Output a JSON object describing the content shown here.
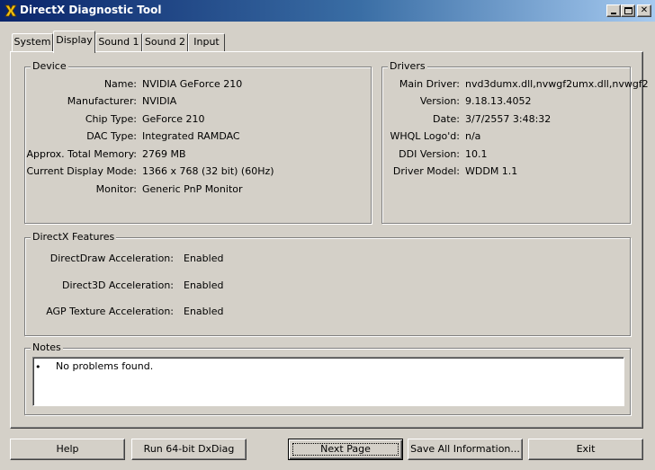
{
  "window": {
    "title": "DirectX Diagnostic Tool"
  },
  "tabs": [
    {
      "label": "System"
    },
    {
      "label": "Display"
    },
    {
      "label": "Sound 1"
    },
    {
      "label": "Sound 2"
    },
    {
      "label": "Input"
    }
  ],
  "active_tab": "Display",
  "device": {
    "title": "Device",
    "fields": [
      {
        "label": "Name:",
        "value": "NVIDIA GeForce 210"
      },
      {
        "label": "Manufacturer:",
        "value": "NVIDIA"
      },
      {
        "label": "Chip Type:",
        "value": "GeForce 210"
      },
      {
        "label": "DAC Type:",
        "value": "Integrated RAMDAC"
      },
      {
        "label": "Approx. Total Memory:",
        "value": "2769 MB"
      },
      {
        "label": "Current Display Mode:",
        "value": "1366 x 768 (32 bit) (60Hz)"
      },
      {
        "label": "Monitor:",
        "value": "Generic PnP Monitor"
      }
    ]
  },
  "drivers": {
    "title": "Drivers",
    "fields": [
      {
        "label": "Main Driver:",
        "value": "nvd3dumx.dll,nvwgf2umx.dll,nvwgf2"
      },
      {
        "label": "Version:",
        "value": "9.18.13.4052"
      },
      {
        "label": "Date:",
        "value": "3/7/2557 3:48:32"
      },
      {
        "label": "WHQL Logo'd:",
        "value": "n/a"
      },
      {
        "label": "DDI Version:",
        "value": "10.1"
      },
      {
        "label": "Driver Model:",
        "value": "WDDM 1.1"
      }
    ]
  },
  "features": {
    "title": "DirectX Features",
    "fields": [
      {
        "label": "DirectDraw Acceleration:",
        "value": "Enabled"
      },
      {
        "label": "Direct3D Acceleration:",
        "value": "Enabled"
      },
      {
        "label": "AGP Texture Acceleration:",
        "value": "Enabled"
      }
    ]
  },
  "notes": {
    "title": "Notes",
    "bullet": "•",
    "items": [
      "No problems found."
    ]
  },
  "buttons": {
    "help": "Help",
    "run64": "Run 64-bit DxDiag",
    "next": "Next Page",
    "save": "Save All Information...",
    "exit": "Exit"
  },
  "colors": {
    "titlebar_start": "#0a246a",
    "titlebar_end": "#a6caf0",
    "face": "#d4d0c8"
  },
  "icons": {
    "app": "directx-x-icon",
    "minimize": "minimize-icon",
    "maximize": "maximize-icon",
    "close": "close-icon"
  }
}
